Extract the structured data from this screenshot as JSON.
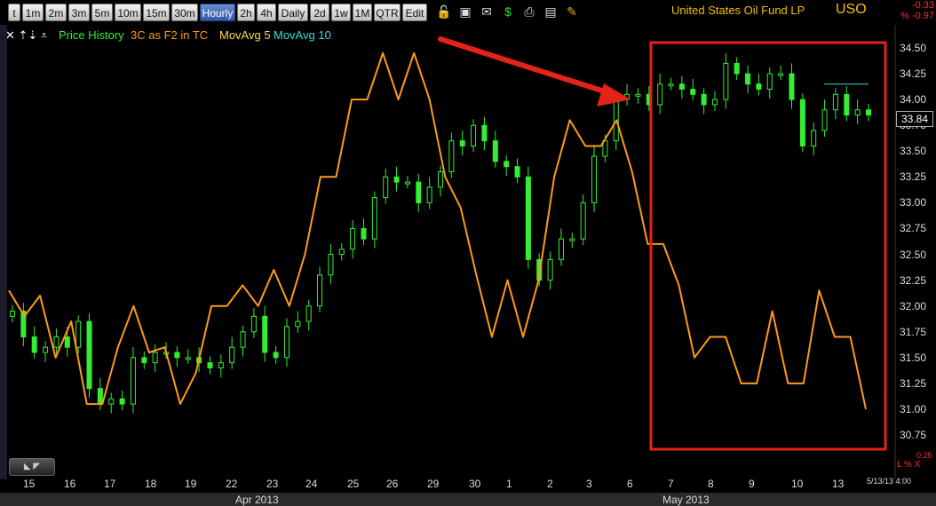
{
  "toolbar": {
    "timeframes": [
      "t",
      "1m",
      "2m",
      "3m",
      "5m",
      "10m",
      "15m",
      "30m",
      "Hourly",
      "2h",
      "4h",
      "Daily",
      "2d",
      "1w",
      "1M",
      "QTR",
      "Edit"
    ],
    "active_timeframe": "Hourly",
    "icons": [
      "lock-icon",
      "save-icon",
      "mail-icon",
      "dollar-icon",
      "print-icon",
      "screen-icon",
      "pencil-icon"
    ]
  },
  "symbol": {
    "name": "United States Oil Fund LP",
    "ticker": "USO",
    "change": "-0.33",
    "change_pct": "% -0.97"
  },
  "legend": {
    "price_history": "Price History",
    "indicator": "3C as F2 in TC",
    "ma5": "MovAvg 5",
    "ma10": "MovAvg 10"
  },
  "colors": {
    "price": "#33ee33",
    "indicator": "#ff9a1a",
    "ma5": "#ffd84a",
    "ma10": "#33dddd",
    "highlight_box": "#e2231a",
    "arrow": "#e2231a"
  },
  "y_axis": [
    "34.50",
    "34.25",
    "34.00",
    "33.75",
    "33.50",
    "33.25",
    "33.00",
    "32.75",
    "32.50",
    "32.25",
    "32.00",
    "31.75",
    "31.50",
    "31.25",
    "31.00",
    "30.75"
  ],
  "last_price": "33.84",
  "x_axis": [
    "15",
    "16",
    "17",
    "18",
    "19",
    "22",
    "23",
    "24",
    "25",
    "26",
    "29",
    "30",
    "1",
    "2",
    "3",
    "6",
    "7",
    "8",
    "9",
    "10",
    "13"
  ],
  "months": [
    "Apr 2013",
    "May 2013"
  ],
  "timestamp": "5/13/13 4:00",
  "pct_readout": "0.25",
  "pct_label": "L % X",
  "chart_data": {
    "type": "line",
    "title": "United States Oil Fund LP",
    "ylim": [
      30.65,
      34.6
    ],
    "x": [
      "15",
      "16",
      "17",
      "18",
      "19",
      "22",
      "23",
      "24",
      "25",
      "26",
      "29",
      "30",
      "1",
      "2",
      "3",
      "6",
      "7",
      "8",
      "9",
      "10",
      "13"
    ],
    "series": [
      {
        "name": "Price History",
        "kind": "candles",
        "closes": [
          31.95,
          31.7,
          31.55,
          31.6,
          31.7,
          31.6,
          31.85,
          31.2,
          31.05,
          31.1,
          31.05,
          31.5,
          31.45,
          31.55,
          31.55,
          31.5,
          31.5,
          31.45,
          31.4,
          31.45,
          31.6,
          31.75,
          31.9,
          31.55,
          31.5,
          31.8,
          31.85,
          32.0,
          32.3,
          32.5,
          32.55,
          32.75,
          32.65,
          33.05,
          33.25,
          33.2,
          33.2,
          33.0,
          33.15,
          33.3,
          33.6,
          33.55,
          33.75,
          33.6,
          33.4,
          33.35,
          33.25,
          32.45,
          32.25,
          32.45,
          32.65,
          32.65,
          33.0,
          33.45,
          33.6,
          34.0,
          34.05,
          34.05,
          33.95,
          34.15,
          34.15,
          34.1,
          34.05,
          33.95,
          34.0,
          34.35,
          34.25,
          34.15,
          34.1,
          34.25,
          34.25,
          34.0,
          33.55,
          33.7,
          33.9,
          34.05,
          33.85,
          33.9,
          33.85
        ]
      },
      {
        "name": "3C as F2 in TC",
        "kind": "line",
        "values": [
          32.15,
          31.9,
          32.1,
          31.5,
          31.85,
          31.05,
          31.05,
          31.6,
          32.0,
          31.55,
          31.6,
          31.05,
          31.35,
          32.0,
          32.0,
          32.2,
          32.0,
          32.35,
          32.0,
          32.5,
          33.25,
          33.25,
          34.0,
          34.0,
          34.45,
          34.0,
          34.45,
          34.0,
          33.25,
          32.95,
          32.3,
          31.7,
          32.25,
          31.7,
          32.25,
          33.25,
          33.8,
          33.55,
          33.55,
          33.8,
          33.3,
          32.6,
          32.6,
          32.2,
          31.5,
          31.7,
          31.7,
          31.25,
          31.25,
          31.95,
          31.25,
          31.25,
          32.15,
          31.7,
          31.7,
          31.0
        ]
      }
    ]
  }
}
